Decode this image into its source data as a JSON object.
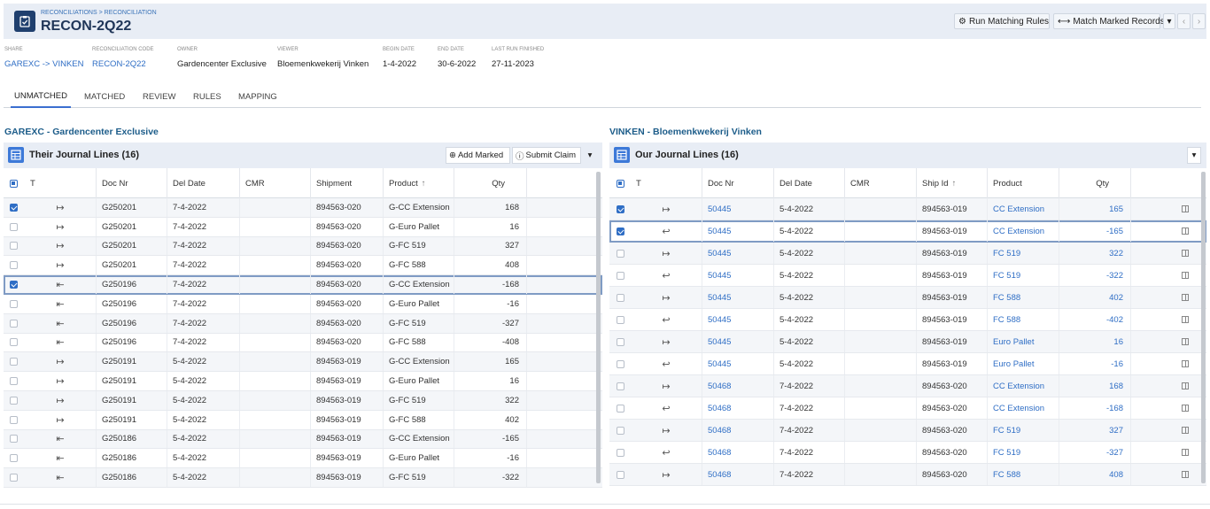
{
  "header": {
    "breadcrumb": "RECONCILIATIONS > RECONCILIATION",
    "title": "RECON-2Q22",
    "actions": {
      "run_rules": "Run Matching Rules",
      "match_marked": "Match Marked Records"
    }
  },
  "meta": [
    {
      "label": "SHARE",
      "value": "GAREXC -> VINKEN",
      "link": true
    },
    {
      "label": "RECONCILIATION CODE",
      "value": "RECON-2Q22",
      "link": true
    },
    {
      "label": "OWNER",
      "value": "Gardencenter Exclusive",
      "link": false
    },
    {
      "label": "VIEWER",
      "value": "Bloemenkwekerij Vinken",
      "link": false
    },
    {
      "label": "BEGIN DATE",
      "value": "1-4-2022",
      "link": false
    },
    {
      "label": "END DATE",
      "value": "30-6-2022",
      "link": false
    },
    {
      "label": "LAST RUN FINISHED",
      "value": "27-11-2023",
      "link": false
    }
  ],
  "tabs": [
    "UNMATCHED",
    "MATCHED",
    "REVIEW",
    "RULES",
    "MAPPING"
  ],
  "active_tab": "UNMATCHED",
  "left": {
    "party_title": "GAREXC - Gardencenter Exclusive",
    "grid_title": "Their Journal Lines (16)",
    "add_marked": "Add Marked",
    "submit_claim": "Submit Claim",
    "columns": [
      "T",
      "Doc Nr",
      "Del Date",
      "CMR",
      "Shipment",
      "Product",
      "Qty"
    ],
    "sort_icon": "↑",
    "rows": [
      {
        "checked": true,
        "dir": "out",
        "doc": "G250201",
        "date": "7-4-2022",
        "cmr": "",
        "ship": "894563-020",
        "product": "G-CC Extension",
        "qty": "168"
      },
      {
        "checked": false,
        "dir": "out",
        "doc": "G250201",
        "date": "7-4-2022",
        "cmr": "",
        "ship": "894563-020",
        "product": "G-Euro Pallet",
        "qty": "16"
      },
      {
        "checked": false,
        "dir": "out",
        "doc": "G250201",
        "date": "7-4-2022",
        "cmr": "",
        "ship": "894563-020",
        "product": "G-FC 519",
        "qty": "327"
      },
      {
        "checked": false,
        "dir": "out",
        "doc": "G250201",
        "date": "7-4-2022",
        "cmr": "",
        "ship": "894563-020",
        "product": "G-FC 588",
        "qty": "408"
      },
      {
        "checked": true,
        "dir": "in",
        "doc": "G250196",
        "date": "7-4-2022",
        "cmr": "",
        "ship": "894563-020",
        "product": "G-CC Extension",
        "qty": "-168"
      },
      {
        "checked": false,
        "dir": "in",
        "doc": "G250196",
        "date": "7-4-2022",
        "cmr": "",
        "ship": "894563-020",
        "product": "G-Euro Pallet",
        "qty": "-16"
      },
      {
        "checked": false,
        "dir": "in",
        "doc": "G250196",
        "date": "7-4-2022",
        "cmr": "",
        "ship": "894563-020",
        "product": "G-FC 519",
        "qty": "-327"
      },
      {
        "checked": false,
        "dir": "in",
        "doc": "G250196",
        "date": "7-4-2022",
        "cmr": "",
        "ship": "894563-020",
        "product": "G-FC 588",
        "qty": "-408"
      },
      {
        "checked": false,
        "dir": "out",
        "doc": "G250191",
        "date": "5-4-2022",
        "cmr": "",
        "ship": "894563-019",
        "product": "G-CC Extension",
        "qty": "165"
      },
      {
        "checked": false,
        "dir": "out",
        "doc": "G250191",
        "date": "5-4-2022",
        "cmr": "",
        "ship": "894563-019",
        "product": "G-Euro Pallet",
        "qty": "16"
      },
      {
        "checked": false,
        "dir": "out",
        "doc": "G250191",
        "date": "5-4-2022",
        "cmr": "",
        "ship": "894563-019",
        "product": "G-FC 519",
        "qty": "322"
      },
      {
        "checked": false,
        "dir": "out",
        "doc": "G250191",
        "date": "5-4-2022",
        "cmr": "",
        "ship": "894563-019",
        "product": "G-FC 588",
        "qty": "402"
      },
      {
        "checked": false,
        "dir": "in",
        "doc": "G250186",
        "date": "5-4-2022",
        "cmr": "",
        "ship": "894563-019",
        "product": "G-CC Extension",
        "qty": "-165"
      },
      {
        "checked": false,
        "dir": "in",
        "doc": "G250186",
        "date": "5-4-2022",
        "cmr": "",
        "ship": "894563-019",
        "product": "G-Euro Pallet",
        "qty": "-16"
      },
      {
        "checked": false,
        "dir": "in",
        "doc": "G250186",
        "date": "5-4-2022",
        "cmr": "",
        "ship": "894563-019",
        "product": "G-FC 519",
        "qty": "-322"
      }
    ]
  },
  "right": {
    "party_title": "VINKEN - Bloemenkwekerij Vinken",
    "grid_title": "Our Journal Lines (16)",
    "columns": [
      "T",
      "Doc Nr",
      "Del Date",
      "CMR",
      "Ship Id",
      "Product",
      "Qty"
    ],
    "sort_icon": "↑",
    "rows": [
      {
        "checked": true,
        "dir": "out",
        "doc": "50445",
        "date": "5-4-2022",
        "cmr": "",
        "ship": "894563-019",
        "product": "CC Extension",
        "qty": "165"
      },
      {
        "checked": true,
        "dir": "in",
        "doc": "50445",
        "date": "5-4-2022",
        "cmr": "",
        "ship": "894563-019",
        "product": "CC Extension",
        "qty": "-165"
      },
      {
        "checked": false,
        "dir": "out",
        "doc": "50445",
        "date": "5-4-2022",
        "cmr": "",
        "ship": "894563-019",
        "product": "FC 519",
        "qty": "322"
      },
      {
        "checked": false,
        "dir": "in",
        "doc": "50445",
        "date": "5-4-2022",
        "cmr": "",
        "ship": "894563-019",
        "product": "FC 519",
        "qty": "-322"
      },
      {
        "checked": false,
        "dir": "out",
        "doc": "50445",
        "date": "5-4-2022",
        "cmr": "",
        "ship": "894563-019",
        "product": "FC 588",
        "qty": "402"
      },
      {
        "checked": false,
        "dir": "in",
        "doc": "50445",
        "date": "5-4-2022",
        "cmr": "",
        "ship": "894563-019",
        "product": "FC 588",
        "qty": "-402"
      },
      {
        "checked": false,
        "dir": "out",
        "doc": "50445",
        "date": "5-4-2022",
        "cmr": "",
        "ship": "894563-019",
        "product": "Euro Pallet",
        "qty": "16"
      },
      {
        "checked": false,
        "dir": "in",
        "doc": "50445",
        "date": "5-4-2022",
        "cmr": "",
        "ship": "894563-019",
        "product": "Euro Pallet",
        "qty": "-16"
      },
      {
        "checked": false,
        "dir": "out",
        "doc": "50468",
        "date": "7-4-2022",
        "cmr": "",
        "ship": "894563-020",
        "product": "CC Extension",
        "qty": "168"
      },
      {
        "checked": false,
        "dir": "in",
        "doc": "50468",
        "date": "7-4-2022",
        "cmr": "",
        "ship": "894563-020",
        "product": "CC Extension",
        "qty": "-168"
      },
      {
        "checked": false,
        "dir": "out",
        "doc": "50468",
        "date": "7-4-2022",
        "cmr": "",
        "ship": "894563-020",
        "product": "FC 519",
        "qty": "327"
      },
      {
        "checked": false,
        "dir": "in",
        "doc": "50468",
        "date": "7-4-2022",
        "cmr": "",
        "ship": "894563-020",
        "product": "FC 519",
        "qty": "-327"
      },
      {
        "checked": false,
        "dir": "out",
        "doc": "50468",
        "date": "7-4-2022",
        "cmr": "",
        "ship": "894563-020",
        "product": "FC 588",
        "qty": "408"
      }
    ]
  },
  "icons": {
    "dir_out": "↦",
    "dir_in_left": "⇤",
    "dir_in_right": "↩",
    "run_rules": "⚙",
    "match": "⟷",
    "add": "⊕",
    "submit": "ⓘ",
    "drop": "▾",
    "prev": "‹",
    "next": "›"
  },
  "colors": {
    "accent": "#3d79d8",
    "link": "#2f6ec5",
    "title": "#1d5d8a"
  }
}
